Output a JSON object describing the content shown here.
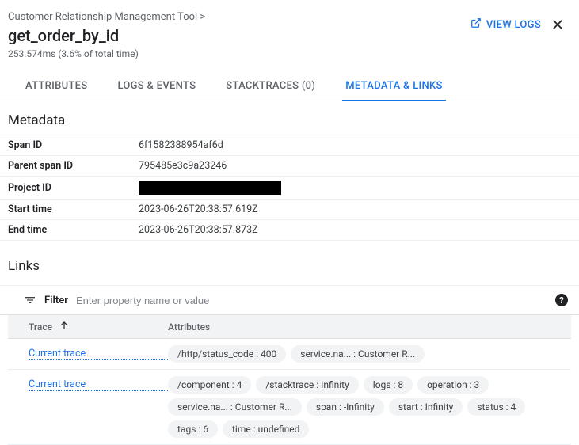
{
  "header": {
    "breadcrumb": "Customer Relationship Management Tool >",
    "title": "get_order_by_id",
    "subtitle": "253.574ms  (3.6% of total time)",
    "view_logs_label": "VIEW LOGS"
  },
  "tabs": {
    "attributes": "ATTRIBUTES",
    "logs_events": "LOGS & EVENTS",
    "stacktraces": "STACKTRACES (0)",
    "metadata_links": "METADATA & LINKS"
  },
  "metadata": {
    "heading": "Metadata",
    "rows": {
      "span_id": {
        "k": "Span ID",
        "v": "6f1582388954af6d"
      },
      "parent_span_id": {
        "k": "Parent span ID",
        "v": "795485e3c9a23246"
      },
      "project_id": {
        "k": "Project ID",
        "v": ""
      },
      "start_time": {
        "k": "Start time",
        "v": "2023-06-26T20:38:57.619Z"
      },
      "end_time": {
        "k": "End time",
        "v": "2023-06-26T20:38:57.873Z"
      }
    }
  },
  "links": {
    "heading": "Links",
    "filter_label": "Filter",
    "filter_placeholder": "Enter property name or value",
    "col_trace": "Trace",
    "col_attrs": "Attributes",
    "rows": {
      "r0": {
        "trace_label": "Current trace",
        "chips": {
          "c0": "/http/status_code : 400",
          "c1": "service.na... : Customer R..."
        }
      },
      "r1": {
        "trace_label": "Current trace",
        "chips": {
          "c0": "/component : 4",
          "c1": "/stacktrace : Infinity",
          "c2": "logs : 8",
          "c3": "operation : 3",
          "c4": "service.na... : Customer R...",
          "c5": "span : -Infinity",
          "c6": "start : Infinity",
          "c7": "status : 4",
          "c8": "tags : 6",
          "c9": "time : undefined"
        }
      }
    }
  }
}
